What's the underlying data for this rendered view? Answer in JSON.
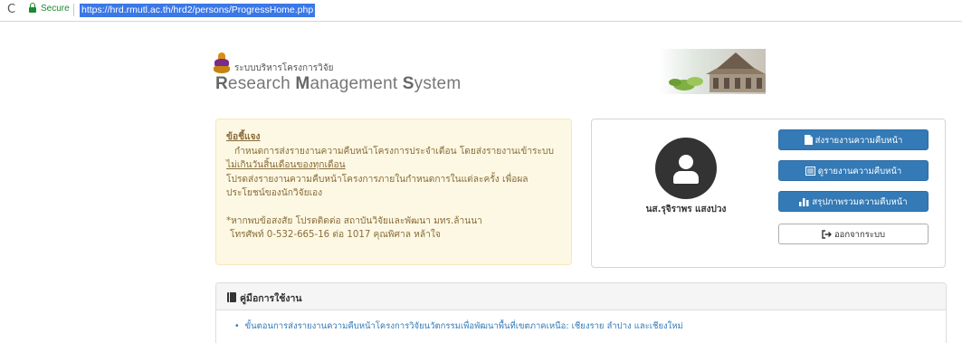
{
  "browser": {
    "reload_glyph": "C",
    "secure_label": "Secure",
    "url": "https://hrd.rmutl.ac.th/hrd2/persons/ProgressHome.php"
  },
  "header": {
    "system_name_th": "ระบบบริหารโครงการวิจัย",
    "system_name_en": {
      "w1_first": "R",
      "w1_rest": "esearch ",
      "w2_first": "M",
      "w2_rest": "anagement ",
      "w3_first": "S",
      "w3_rest": "ystem"
    }
  },
  "notice": {
    "title": "ข้อชี้แจง",
    "line1": "กำหนดการส่งรายงานความคืบหน้าโครงการประจำเดือน โดยส่งรายงานเข้าระบบ",
    "line2": "ไม่เกินวันสิ้นเดือนของทุกเดือน",
    "line3": "โปรดส่งรายงานความคืบหน้าโครงการภายในกำหนดการในแต่ละครั้ง เพื่อผล",
    "line4": "ประโยชน์ของนักวิจัยเอง",
    "contact1": "*หากพบข้อสงสัย โปรดติดต่อ สถาบันวิจัยและพัฒนา มทร.ล้านนา",
    "contact2": "โทรศัพท์ 0-532-665-16 ต่อ 1017 คุณพิศาล หล้าใจ"
  },
  "profile": {
    "name": "นส.รุจิราพร แสงปวง",
    "buttons": {
      "send_report": "ส่งรายงานความคืบหน้า",
      "view_report": "ดูรายงานความคืบหน้า",
      "summary": "สรุปภาพรวมความคืบหน้า",
      "logout": "ออกจากระบบ"
    }
  },
  "manual": {
    "title": "คู่มือการใช้งาน",
    "items": [
      "ขั้นตอนการส่งรายงานความคืบหน้าโครงการวิจัยนวัตกรรมเพื่อพัฒนาพื้นที่เขตภาคเหนือ: เชียงราย ลำปาง และเชียงใหม่"
    ]
  },
  "colors": {
    "primary": "#337ab7",
    "notice_bg": "#fcf8e3",
    "notice_text": "#8a6d3b",
    "secure_green": "#1a8a35",
    "url_highlight": "#3b78e7"
  }
}
